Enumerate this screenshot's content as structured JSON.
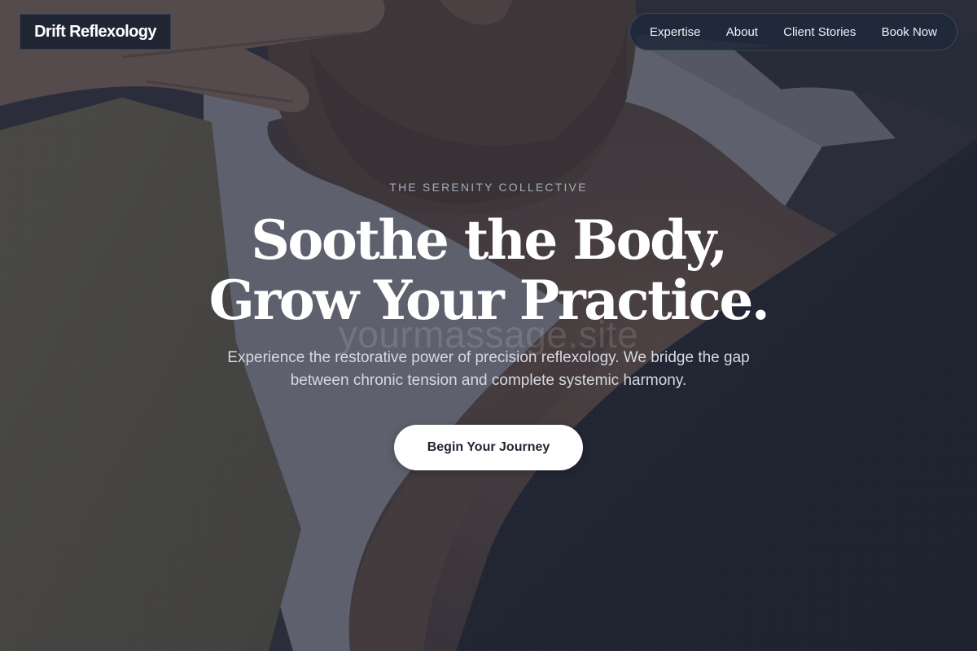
{
  "brand": {
    "name": "Drift Reflexology"
  },
  "nav": {
    "items": [
      {
        "label": "Expertise"
      },
      {
        "label": "About"
      },
      {
        "label": "Client Stories"
      },
      {
        "label": "Book Now"
      }
    ]
  },
  "hero": {
    "eyebrow": "THE SERENITY COLLECTIVE",
    "headline_line1": "Soothe the Body,",
    "headline_line2": "Grow Your Practice.",
    "watermark": "yourmassage.site",
    "subtitle": "Experience the restorative power of precision reflexology. We bridge the gap between chronic tension and complete systemic harmony.",
    "cta_label": "Begin Your Journey",
    "image": "massage-therapist-hands-on-client-neck-photo"
  },
  "colors": {
    "overlay": "#2b2f3b",
    "header_bg": "#1f2533",
    "cta_bg": "#ffffff",
    "cta_text": "#1f2533"
  }
}
